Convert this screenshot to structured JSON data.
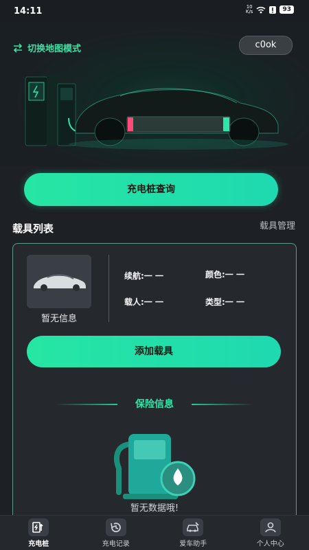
{
  "status_bar": {
    "time": "14:11",
    "net_speed_value": "10",
    "net_speed_unit": "K/s",
    "battery": "93"
  },
  "header": {
    "switch_mode_label": "切换地图模式",
    "user_name": "c0ok"
  },
  "query_button_label": "充电桩查询",
  "vehicle_section": {
    "title": "载具列表",
    "manage_label": "载具管理"
  },
  "vehicle_card": {
    "no_info_label": "暂无信息",
    "range_label": "续航:一 一",
    "color_label": "颜色:一 一",
    "capacity_label": "载人:一 一",
    "type_label": "类型:一 一",
    "add_button_label": "添加载具",
    "insurance_title": "保险信息",
    "empty_text": "暂无数据哦!"
  },
  "tabbar": {
    "items": [
      {
        "label": "充电桩",
        "icon": "charging-pile-icon",
        "active": true
      },
      {
        "label": "充电记录",
        "icon": "history-icon",
        "active": false
      },
      {
        "label": "爱车助手",
        "icon": "car-assistant-icon",
        "active": false
      },
      {
        "label": "个人中心",
        "icon": "profile-icon",
        "active": false
      }
    ]
  },
  "colors": {
    "accent": "#26e6a3",
    "background": "#1d2126",
    "card": "#25292e"
  }
}
